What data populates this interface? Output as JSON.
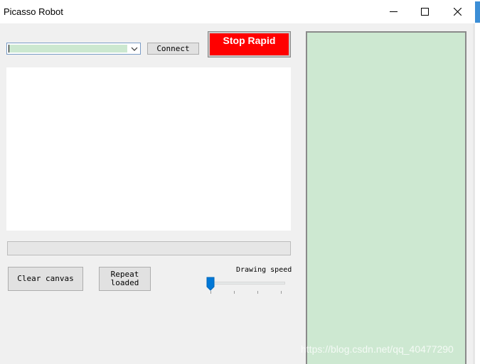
{
  "window": {
    "title": "Picasso Robot",
    "controls": [
      "minimize",
      "maximize",
      "close"
    ]
  },
  "port_select": {
    "value": ""
  },
  "buttons": {
    "connect": "Connect",
    "stop": "Stop Rapid",
    "clear": "Clear canvas",
    "repeat": "Repeat\nloaded"
  },
  "speed": {
    "label": "Drawing speed",
    "value_fraction": 0
  },
  "progress": {
    "value": 0
  },
  "watermark": "https://blog.csdn.net/qq_40477290",
  "colors": {
    "stop_button": "#ff0000",
    "canvas": "#cde8d1",
    "combo_fill": "#cce8d0",
    "slider_thumb": "#0078d7"
  }
}
